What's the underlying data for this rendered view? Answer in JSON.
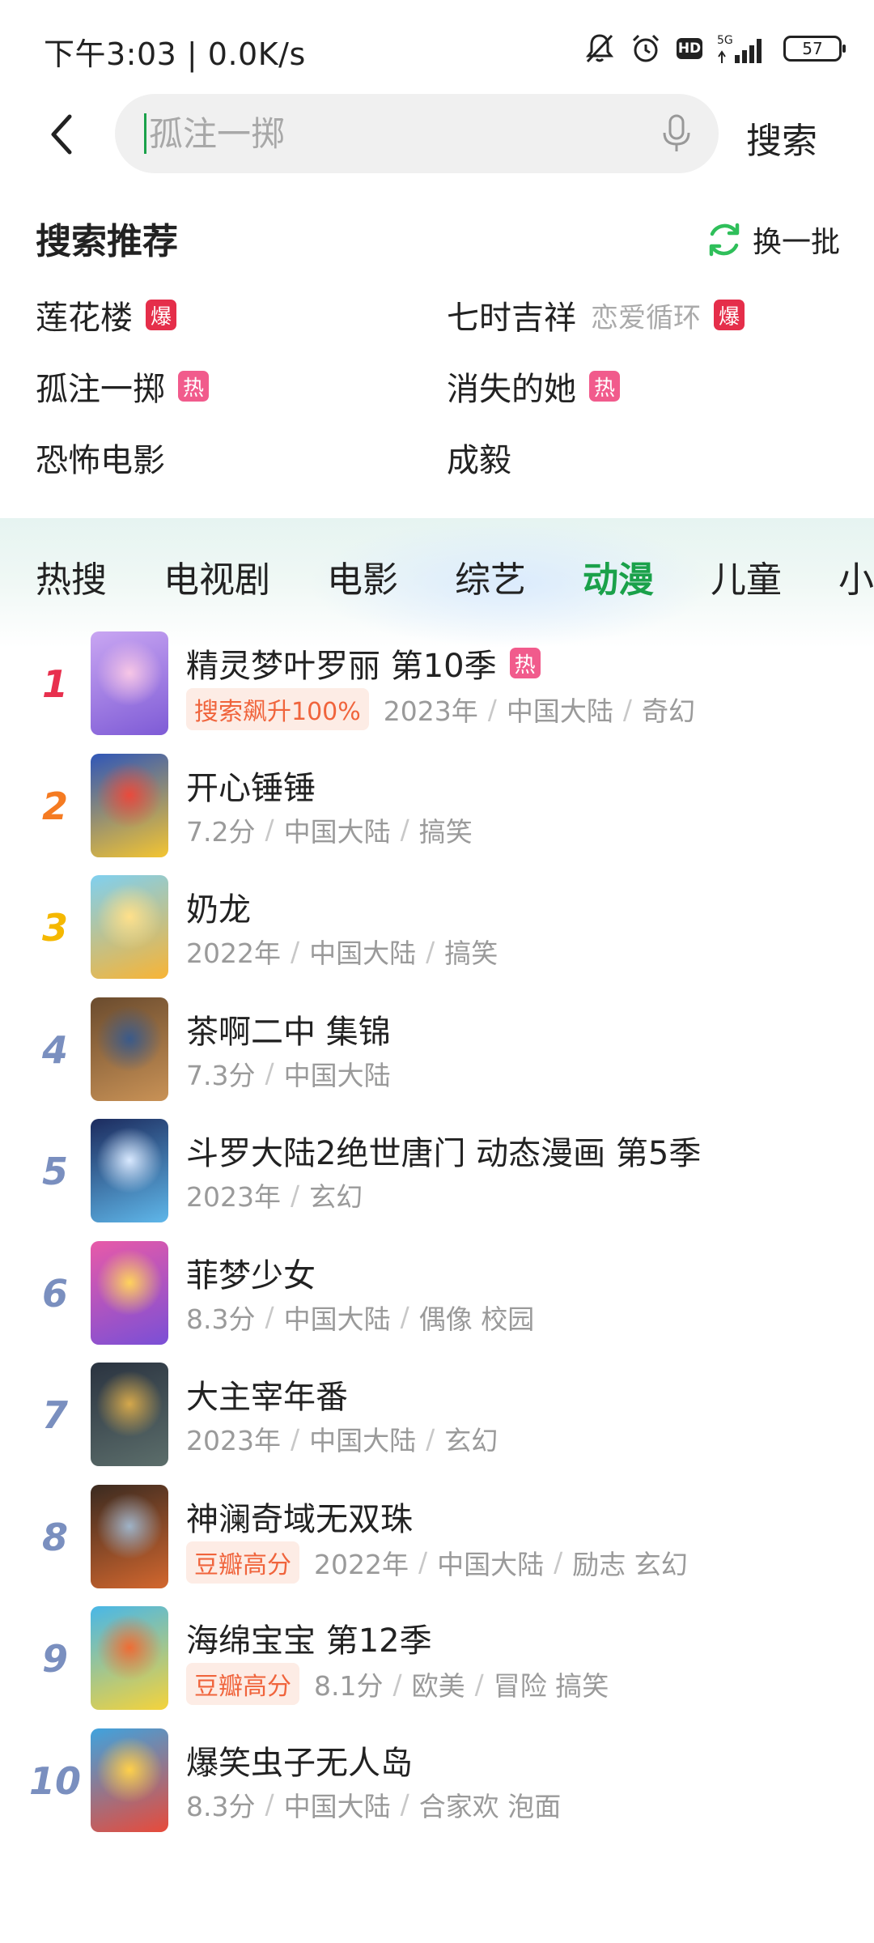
{
  "status_bar": {
    "time": "下午3:03 | 0.0K/s",
    "network": "5G",
    "battery": "57",
    "icons": [
      "mute-bell-icon",
      "alarm-icon",
      "hd-icon",
      "signal-icon",
      "battery-icon"
    ]
  },
  "search": {
    "placeholder": "孤注一掷",
    "button_label": "搜索"
  },
  "recommendations": {
    "title": "搜索推荐",
    "refresh_label": "换一批",
    "items": [
      {
        "label": "莲花楼",
        "sub": "",
        "tag": "爆",
        "tag_type": "burst"
      },
      {
        "label": "七时吉祥",
        "sub": "恋爱循环",
        "tag": "爆",
        "tag_type": "burst"
      },
      {
        "label": "孤注一掷",
        "sub": "",
        "tag": "热",
        "tag_type": "hot"
      },
      {
        "label": "消失的她",
        "sub": "",
        "tag": "热",
        "tag_type": "hot"
      },
      {
        "label": "恐怖电影",
        "sub": "",
        "tag": "",
        "tag_type": ""
      },
      {
        "label": "成毅",
        "sub": "",
        "tag": "",
        "tag_type": ""
      }
    ]
  },
  "tabs": {
    "items": [
      "热搜",
      "电视剧",
      "电影",
      "综艺",
      "动漫",
      "儿童",
      "小"
    ],
    "active_index": 4
  },
  "ranking": [
    {
      "rank": "1",
      "title": "精灵梦叶罗丽 第10季",
      "title_tag": "热",
      "badge": "搜索飙升100%",
      "meta": [
        "2023年",
        "中国大陆",
        "奇幻"
      ]
    },
    {
      "rank": "2",
      "title": "开心锤锤",
      "title_tag": "",
      "badge": "",
      "meta": [
        "7.2分",
        "中国大陆",
        "搞笑"
      ]
    },
    {
      "rank": "3",
      "title": "奶龙",
      "title_tag": "",
      "badge": "",
      "meta": [
        "2022年",
        "中国大陆",
        "搞笑"
      ]
    },
    {
      "rank": "4",
      "title": "茶啊二中 集锦",
      "title_tag": "",
      "badge": "",
      "meta": [
        "7.3分",
        "中国大陆"
      ]
    },
    {
      "rank": "5",
      "title": "斗罗大陆2绝世唐门 动态漫画 第5季",
      "title_tag": "",
      "badge": "",
      "meta": [
        "2023年",
        "玄幻"
      ]
    },
    {
      "rank": "6",
      "title": "菲梦少女",
      "title_tag": "",
      "badge": "",
      "meta": [
        "8.3分",
        "中国大陆",
        "偶像 校园"
      ]
    },
    {
      "rank": "7",
      "title": "大主宰年番",
      "title_tag": "",
      "badge": "",
      "meta": [
        "2023年",
        "中国大陆",
        "玄幻"
      ]
    },
    {
      "rank": "8",
      "title": "神澜奇域无双珠",
      "title_tag": "",
      "badge": "豆瓣高分",
      "meta": [
        "2022年",
        "中国大陆",
        "励志 玄幻"
      ]
    },
    {
      "rank": "9",
      "title": "海绵宝宝 第12季",
      "title_tag": "",
      "badge": "豆瓣高分",
      "meta": [
        "8.1分",
        "欧美",
        "冒险 搞笑"
      ]
    },
    {
      "rank": "10",
      "title": "爆笑虫子无人岛",
      "title_tag": "",
      "badge": "",
      "meta": [
        "8.3分",
        "中国大陆",
        "合家欢 泡面"
      ]
    }
  ],
  "colors": {
    "accent_green": "#1aa14a",
    "rank_1": "#e8304e",
    "rank_2": "#f57b22",
    "rank_3": "#f5b800",
    "rank_other": "#7a8fbf",
    "tag_hot": "#f15b8c",
    "tag_burst": "#e52e4a"
  }
}
